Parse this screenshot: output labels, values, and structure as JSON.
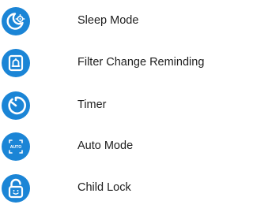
{
  "accent_color": "#1b85d6",
  "features": [
    {
      "label": "Sleep Mode",
      "icon": "sleep-mode-icon"
    },
    {
      "label": "Filter Change Reminding",
      "icon": "filter-reminder-icon"
    },
    {
      "label": "Timer",
      "icon": "timer-icon"
    },
    {
      "label": "Auto Mode",
      "icon": "auto-mode-icon",
      "icon_text": "AUTO"
    },
    {
      "label": "Child Lock",
      "icon": "child-lock-icon"
    }
  ]
}
